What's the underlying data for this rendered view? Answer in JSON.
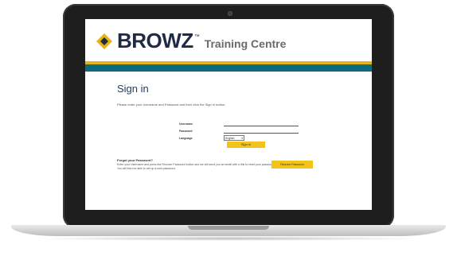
{
  "brand": {
    "name": "BROWZ",
    "tm": "™",
    "subtitle": "Training Centre",
    "colors": {
      "navy": "#1f2a44",
      "gold": "#e6b312",
      "teal": "#0b6b7c",
      "yellow_button": "#f2c318"
    }
  },
  "signin": {
    "title": "Sign in",
    "instructions": "Please enter your Username and Password and then click the Sign in button."
  },
  "form": {
    "username_label": "Username",
    "password_label": "Password",
    "language_label": "Language",
    "language_value": "English",
    "signin_button": "Sign in"
  },
  "forgot": {
    "title": "Forgot your Password?",
    "line1": "Enter your Username and press the Recover Password button and we will send you an email with a link to reset your password.",
    "line2": "You will then be able to set up a new password.",
    "recover_button": "Recover Password"
  }
}
